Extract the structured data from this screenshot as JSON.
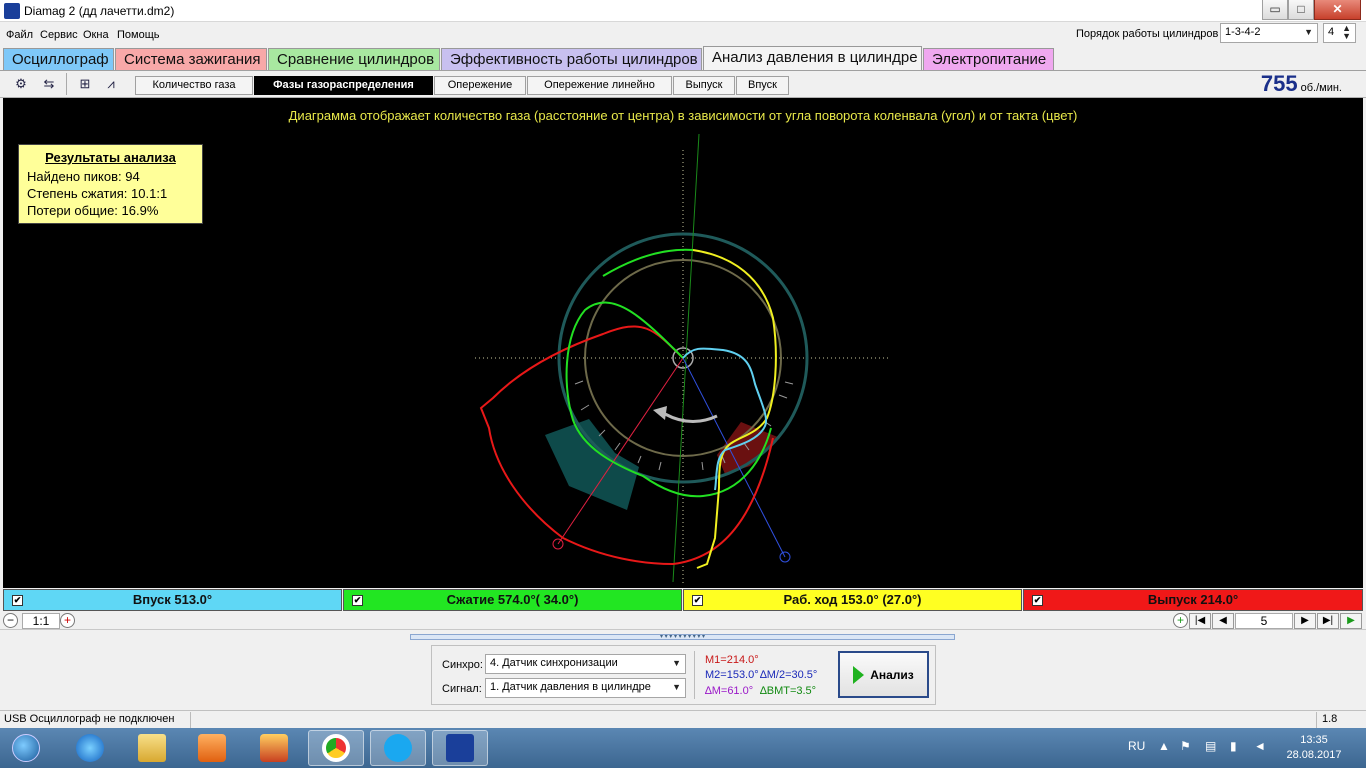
{
  "window": {
    "title": "Diamag 2 (дд лачетти.dm2)",
    "min": "▭",
    "max": "□",
    "close": "✕"
  },
  "menu": [
    "Файл",
    "Сервис",
    "Окна",
    "Помощь"
  ],
  "cylinder_order": {
    "label": "Порядок работы цилиндров",
    "value": "1-3-4-2",
    "count": "4"
  },
  "main_tabs": [
    {
      "label": "Осциллограф",
      "color": "#7ec8f8"
    },
    {
      "label": "Система зажигания",
      "color": "#f8a8a8"
    },
    {
      "label": "Сравнение цилиндров",
      "color": "#a8e8a0"
    },
    {
      "label": "Эффективность работы цилиндров",
      "color": "#c8c0f0"
    },
    {
      "label": "Анализ давления в цилиндре",
      "color": "#f4f4f4"
    },
    {
      "label": "Электропитание",
      "color": "#f0a8f0"
    }
  ],
  "sub_tabs": [
    "Количество газа",
    "Фазы газораспределения",
    "Опережение",
    "Опережение линейно",
    "Выпуск",
    "Впуск"
  ],
  "toolbar_icons": [
    "cylinder-settings-icon",
    "numbering-icon",
    "auto-scale-icon",
    "averaging-icon"
  ],
  "toolbar_icon_text": [
    "⚙",
    "⇆",
    "⊞",
    "⩘"
  ],
  "rpm": {
    "value": "755",
    "unit": "об./мин."
  },
  "diagram": {
    "caption": "Диаграмма отображает количество газа (расстояние от центра) в зависимости от угла поворота коленвала (угол) и от такта (цвет)"
  },
  "results": {
    "heading": "Результаты анализа",
    "peaks": "Найдено пиков: 94",
    "compression": "Степень сжатия: 10.1:1",
    "losses": "Потери общие: 16.9%"
  },
  "phases": [
    {
      "label": "Впуск 513.0°",
      "color": "#5fd7f5",
      "checked": "✔"
    },
    {
      "label": "Сжатие 574.0°( 34.0°)",
      "color": "#22e622",
      "checked": "✔"
    },
    {
      "label": "Раб. ход 153.0° (27.0°)",
      "color": "#ffff22",
      "checked": "✔"
    },
    {
      "label": "Выпуск 214.0°",
      "color": "#f01818",
      "checked": "✔"
    }
  ],
  "zoom": {
    "minus": "−",
    "ratio": "1:1",
    "plus": "+"
  },
  "navigation": {
    "add": "+",
    "first": "|◀",
    "prev": "◀",
    "page": "5",
    "next": "▶",
    "last": "▶|",
    "play": "▶"
  },
  "controls": {
    "sync_label": "Синхро:",
    "sync_value": "4.  Датчик синхронизации",
    "signal_label": "Сигнал:",
    "signal_value": "1.  Датчик давления в цилиндре",
    "m1": "M1=214.0°",
    "m2": "M2=153.0°",
    "dm2": "∆M/2=30.5°",
    "dm": "∆M=61.0°",
    "dbmt": "∆BMT=3.5°",
    "analyze": "Анализ"
  },
  "status": {
    "left": "USB Осциллограф не подключен",
    "right": "1.8"
  },
  "taskbar": {
    "apps": [
      "start-icon",
      "ie-icon",
      "explorer-icon",
      "media-icon",
      "app-icon",
      "chrome-icon",
      "skype-icon",
      "diamag-icon"
    ],
    "lang": "RU",
    "time": "13:35",
    "date": "28.08.2017"
  }
}
